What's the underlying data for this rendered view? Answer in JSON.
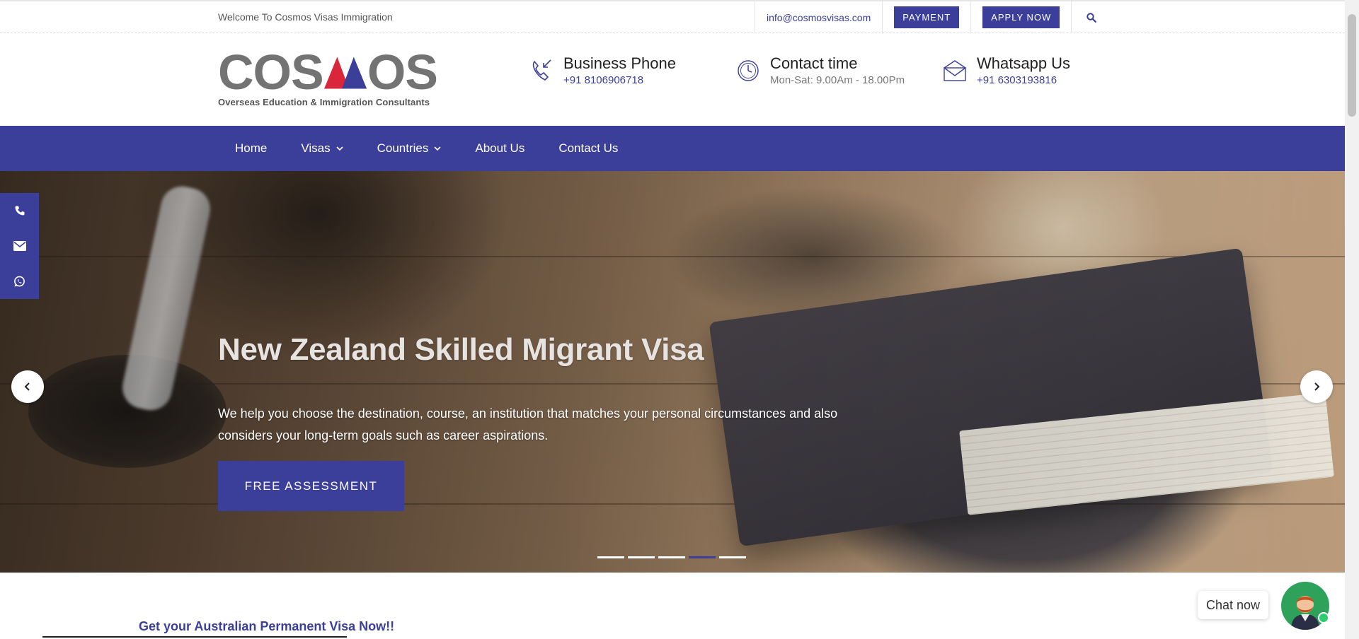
{
  "topbar": {
    "welcome": "Welcome To Cosmos Visas Immigration",
    "email": "info@cosmosvisas.com",
    "payment_label": "PAYMENT",
    "apply_label": "APPLY NOW",
    "search_icon": "search-icon"
  },
  "logo": {
    "text": "COSMOS",
    "tagline": "Overseas Education & Immigration Consultants"
  },
  "contacts": [
    {
      "icon": "phone-incoming-icon",
      "title": "Business Phone",
      "sub": "+91 8106906718"
    },
    {
      "icon": "clock-icon",
      "title": "Contact time",
      "sub": "Mon-Sat: 9.00Am - 18.00Pm"
    },
    {
      "icon": "envelope-icon",
      "title": "Whatsapp Us",
      "sub": "+91 6303193816"
    }
  ],
  "nav": {
    "items": [
      {
        "label": "Home",
        "dropdown": false
      },
      {
        "label": "Visas",
        "dropdown": true
      },
      {
        "label": "Countries",
        "dropdown": true
      },
      {
        "label": "About Us",
        "dropdown": false
      },
      {
        "label": "Contact Us",
        "dropdown": false
      }
    ]
  },
  "hero": {
    "title": "New Zealand Skilled Migrant Visa",
    "text": "We help you choose the destination, course, an institution that matches your personal circumstances and also considers your long-term goals such as career aspirations.",
    "cta": "FREE ASSESSMENT",
    "slides_total": 5,
    "active_slide": 4
  },
  "side_social": [
    "phone-icon",
    "mail-icon",
    "whatsapp-icon"
  ],
  "section": {
    "title": "Get your Australian Permanent Visa Now!!"
  },
  "chat": {
    "label": "Chat now"
  },
  "colors": {
    "brand": "#3b3f99",
    "logo_grey": "#737373",
    "logo_red": "#d9263a"
  }
}
